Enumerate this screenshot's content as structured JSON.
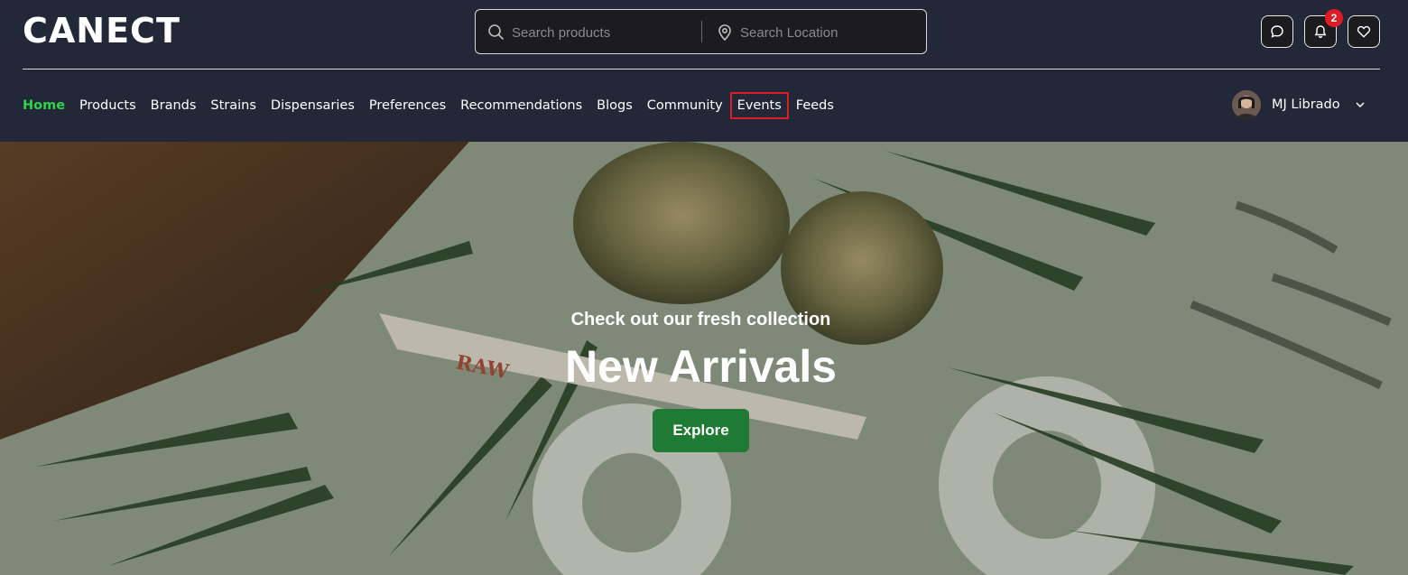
{
  "brand": {
    "logo_text": "CANECT"
  },
  "search": {
    "product_placeholder": "Search products",
    "location_placeholder": "Search Location"
  },
  "header_icons": {
    "chat": "chat-icon",
    "notifications": "bell-icon",
    "notification_count": "2",
    "wishlist": "heart-icon"
  },
  "nav": {
    "items": [
      {
        "label": "Home"
      },
      {
        "label": "Products"
      },
      {
        "label": "Brands"
      },
      {
        "label": "Strains"
      },
      {
        "label": "Dispensaries"
      },
      {
        "label": "Preferences"
      },
      {
        "label": "Recommendations"
      },
      {
        "label": "Blogs"
      },
      {
        "label": "Community"
      },
      {
        "label": "Events"
      },
      {
        "label": "Feeds"
      }
    ]
  },
  "user": {
    "name": "MJ Librado"
  },
  "hero": {
    "subtitle": "Check out our fresh collection",
    "title": "New Arrivals",
    "cta_label": "Explore",
    "background_text": "RAW"
  },
  "colors": {
    "header_bg": "#232838",
    "active_nav": "#2fd34a",
    "highlight_box": "#e01b24",
    "badge": "#e01b24",
    "cta": "#1f7a33"
  }
}
